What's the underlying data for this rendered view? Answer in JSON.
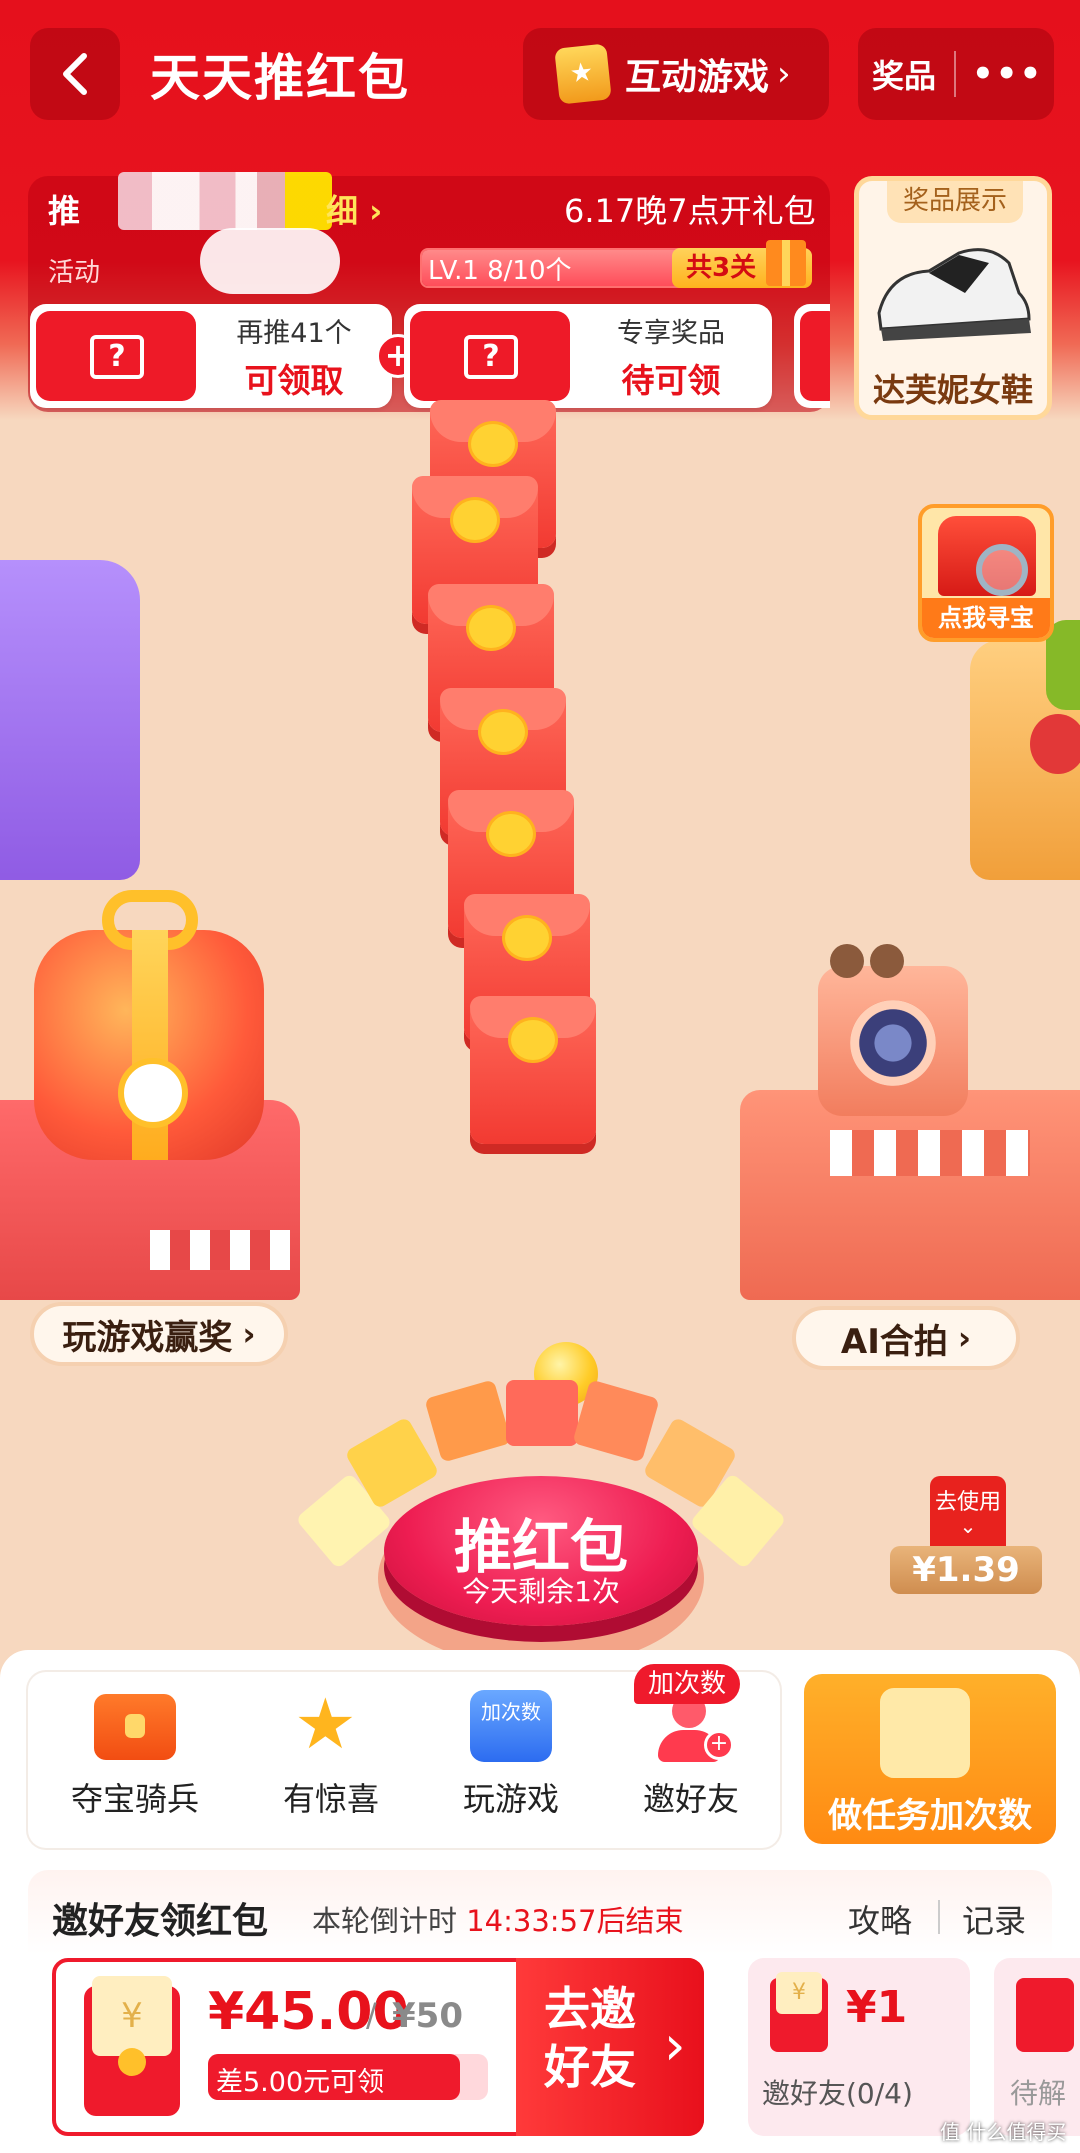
{
  "header": {
    "title": "天天推红包",
    "game_button": "互动游戏",
    "prize_button": "奖品"
  },
  "progress": {
    "push_label": "推",
    "detail_link": "细",
    "open_time": "6.17晚7点开礼包",
    "activity_label": "活动",
    "level_text": "LV.1 8/10个",
    "level_fraction": 0.8,
    "stages": "共3关"
  },
  "rewards": [
    {
      "line1": "再推41个",
      "line2": "可领取"
    },
    {
      "line1": "专享奖品",
      "line2": "待可领"
    }
  ],
  "prize_showcase": {
    "tag": "奖品展示",
    "name": "达芙妮女鞋"
  },
  "treasure": {
    "label": "点我寻宝"
  },
  "play_game": {
    "label": "玩游戏赢奖"
  },
  "ai_photo": {
    "label": "AI合拍"
  },
  "push_button": {
    "title": "推红包",
    "subtitle": "今天剩余1次"
  },
  "coupon": {
    "tag": "去使用",
    "amount": "¥1.39"
  },
  "tools": [
    {
      "label": "夺宝骑兵",
      "icon": "chest-icon"
    },
    {
      "label": "有惊喜",
      "icon": "star-wand-icon"
    },
    {
      "label": "玩游戏",
      "icon": "gamepad-icon",
      "icon_text": "加次数"
    },
    {
      "label": "邀好友",
      "icon": "add-friend-icon"
    }
  ],
  "tools_badge": "加次数",
  "task_button": "做任务加次数",
  "invite": {
    "title": "邀好友领红包",
    "countdown_prefix": "本轮倒计时",
    "countdown": "14:33:57后结束",
    "strategy": "攻略",
    "records": "记录",
    "amount": "¥45.00",
    "separator": "/",
    "total": "¥50",
    "diff_text": "差5.00元可领",
    "progress_fraction": 0.9,
    "go_button": "去邀好友",
    "reward_value": "¥1",
    "reward_label": "邀好友(0/4)",
    "next_label": "待解"
  },
  "watermark": "值 什么值得买",
  "colors": {
    "brand_red": "#e8121c",
    "gold": "#ffc02a",
    "orange": "#ff8a12"
  }
}
